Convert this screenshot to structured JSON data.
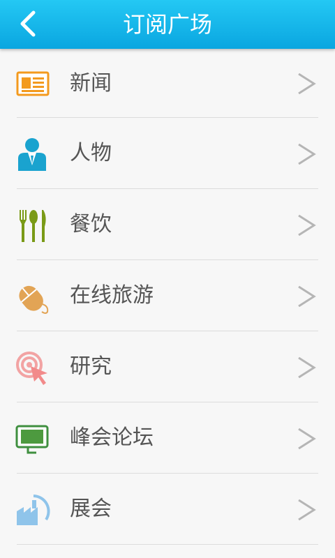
{
  "header": {
    "title": "订阅广场",
    "back_icon": "chevron-left-icon"
  },
  "colors": {
    "header_top": "#24c8f4",
    "header_bottom": "#0aa6e0",
    "chevron": "#b5b5b5",
    "separator": "#dcdcdc"
  },
  "items": [
    {
      "label": "新闻",
      "icon": "newspaper-icon"
    },
    {
      "label": "人物",
      "icon": "person-icon"
    },
    {
      "label": "餐饮",
      "icon": "cutlery-icon"
    },
    {
      "label": "在线旅游",
      "icon": "computer-mouse-icon"
    },
    {
      "label": "研究",
      "icon": "target-cursor-icon"
    },
    {
      "label": "峰会论坛",
      "icon": "monitor-icon"
    },
    {
      "label": "展会",
      "icon": "factory-icon"
    }
  ]
}
